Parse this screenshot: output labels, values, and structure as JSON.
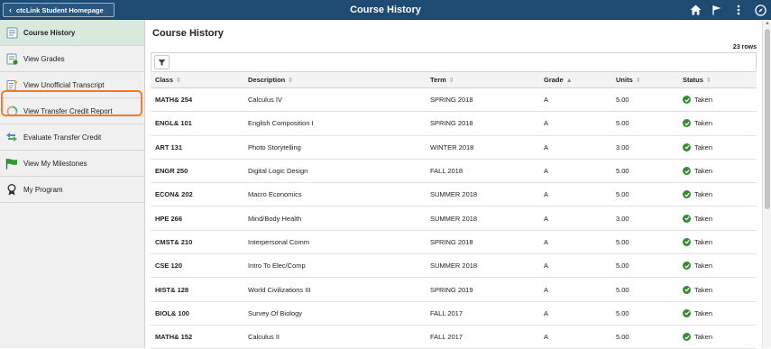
{
  "topbar": {
    "back_label": "ctcLink Student Homepage",
    "title": "Course History",
    "icons": [
      "home-icon",
      "flag-icon",
      "more-icon",
      "compass-icon"
    ]
  },
  "sidebar": {
    "items": [
      {
        "label": "Course History",
        "icon": "course-history-icon",
        "active": true
      },
      {
        "label": "View Grades",
        "icon": "grades-icon",
        "active": false
      },
      {
        "label": "View Unofficial Transcript",
        "icon": "transcript-icon",
        "active": false
      },
      {
        "label": "View Transfer Credit Report",
        "icon": "transfer-report-icon",
        "active": false
      },
      {
        "label": "Evaluate Transfer Credit",
        "icon": "evaluate-transfer-icon",
        "active": false
      },
      {
        "label": "View My Milestones",
        "icon": "milestone-flag-icon",
        "active": false
      },
      {
        "label": "My Program",
        "icon": "program-ribbon-icon",
        "active": false
      }
    ]
  },
  "main": {
    "title": "Course History",
    "rows_count": "23 rows",
    "columns": [
      "Class",
      "Description",
      "Term",
      "Grade",
      "Units",
      "Status"
    ],
    "rows": [
      {
        "class": "MATH& 254",
        "description": "Calculus IV",
        "term": "SPRING 2018",
        "grade": "A",
        "units": "5.00",
        "status": "Taken"
      },
      {
        "class": "ENGL& 101",
        "description": "English Composition I",
        "term": "SPRING 2018",
        "grade": "A",
        "units": "5.00",
        "status": "Taken"
      },
      {
        "class": "ART 131",
        "description": "Photo Storytelling",
        "term": "WINTER 2018",
        "grade": "A",
        "units": "3.00",
        "status": "Taken"
      },
      {
        "class": "ENGR 250",
        "description": "Digital Logic Design",
        "term": "FALL 2018",
        "grade": "A",
        "units": "5.00",
        "status": "Taken"
      },
      {
        "class": "ECON& 202",
        "description": "Macro Economics",
        "term": "SUMMER 2018",
        "grade": "A",
        "units": "5.00",
        "status": "Taken"
      },
      {
        "class": "HPE 266",
        "description": "Mind/Body Health",
        "term": "SUMMER 2018",
        "grade": "A",
        "units": "3.00",
        "status": "Taken"
      },
      {
        "class": "CMST& 210",
        "description": "Interpersonal Comm",
        "term": "SPRING 2018",
        "grade": "A",
        "units": "5.00",
        "status": "Taken"
      },
      {
        "class": "CSE 120",
        "description": "Intro To Elec/Comp",
        "term": "SUMMER 2018",
        "grade": "A",
        "units": "5.00",
        "status": "Taken"
      },
      {
        "class": "HIST& 128",
        "description": "World Civilizations III",
        "term": "SPRING 2019",
        "grade": "A",
        "units": "5.00",
        "status": "Taken"
      },
      {
        "class": "BIOL& 100",
        "description": "Survey Of Biology",
        "term": "FALL 2017",
        "grade": "A",
        "units": "5.00",
        "status": "Taken"
      },
      {
        "class": "MATH& 152",
        "description": "Calculus II",
        "term": "FALL 2017",
        "grade": "A",
        "units": "5.00",
        "status": "Taken"
      }
    ]
  },
  "colors": {
    "topbar": "#1f4a72",
    "active_nav": "#d9e9de",
    "highlight": "#f47b20",
    "status_check": "#3a8a3a"
  }
}
